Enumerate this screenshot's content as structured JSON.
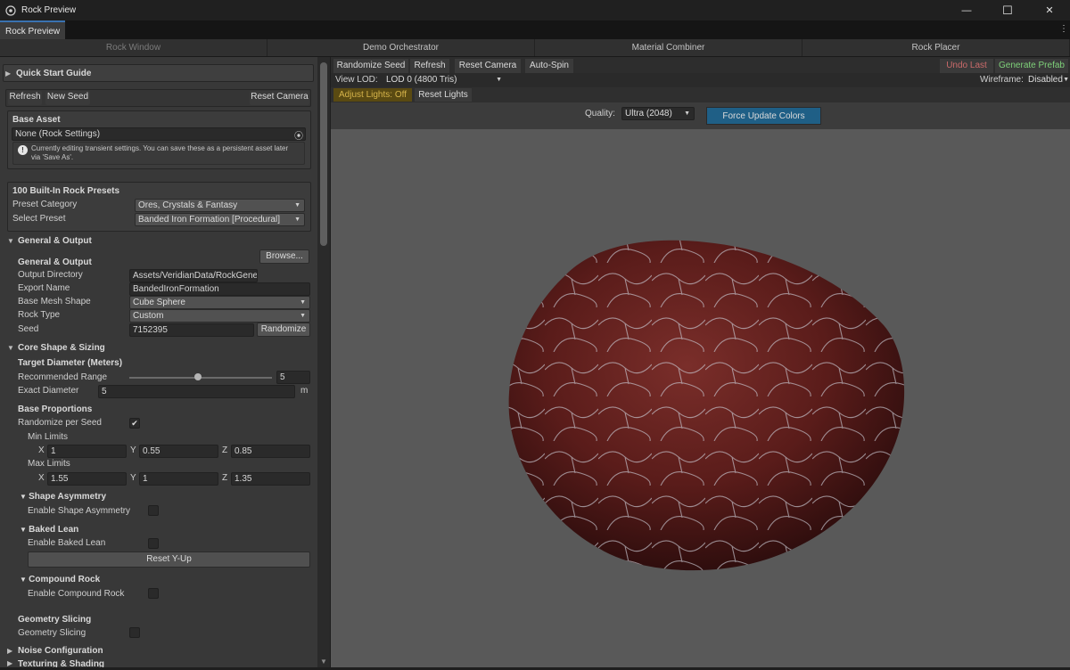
{
  "window": {
    "title": "Rock Preview",
    "controls": {
      "minimize": "—",
      "maximize": "☐",
      "close": "✕"
    }
  },
  "tab": {
    "label": "Rock Preview",
    "menu": "⋮"
  },
  "top_tabs": [
    "Rock Window",
    "Demo Orchestrator",
    "Material Combiner",
    "Rock Placer"
  ],
  "left": {
    "quick_start": "Quick Start Guide",
    "buttons": {
      "refresh": "Refresh",
      "new_seed": "New Seed",
      "reset_camera": "Reset Camera"
    },
    "base_asset": {
      "title": "Base Asset",
      "value": "None (Rock Settings)",
      "info": "Currently editing transient settings. You can save these as a persistent asset later via 'Save As'."
    },
    "presets": {
      "title": "100 Built-In Rock Presets",
      "category_label": "Preset Category",
      "category_value": "Ores, Crystals & Fantasy",
      "select_label": "Select Preset",
      "select_value": "Banded Iron Formation [Procedural]"
    },
    "general": {
      "foldout": "General & Output",
      "browse": "Browse...",
      "header": "General & Output",
      "output_dir_label": "Output Directory",
      "output_dir_value": "Assets/VeridianData/RockGener-",
      "export_label": "Export Name",
      "export_value": "BandedIronFormation",
      "mesh_label": "Base Mesh Shape",
      "mesh_value": "Cube Sphere",
      "type_label": "Rock Type",
      "type_value": "Custom",
      "seed_label": "Seed",
      "seed_value": "7152395",
      "randomize": "Randomize"
    },
    "core": {
      "foldout": "Core Shape & Sizing",
      "target_header": "Target Diameter (Meters)",
      "recommended_label": "Recommended Range",
      "recommended_value": "5",
      "recommended_fraction": 0.48,
      "exact_label": "Exact Diameter",
      "exact_value": "5",
      "exact_unit": "m",
      "proportions_header": "Base Proportions",
      "randomize_label": "Randomize per Seed",
      "randomize_checked": true,
      "min_label": "Min Limits",
      "min": {
        "x": "1",
        "y": "0.55",
        "z": "0.85"
      },
      "max_label": "Max Limits",
      "max": {
        "x": "1.55",
        "y": "1",
        "z": "1.35"
      },
      "axis": {
        "x": "X",
        "y": "Y",
        "z": "Z"
      },
      "asym_header": "Shape Asymmetry",
      "asym_label": "Enable Shape Asymmetry",
      "lean_header": "Baked Lean",
      "lean_label": "Enable Baked Lean",
      "reset_yup": "Reset Y-Up",
      "compound_header": "Compound Rock",
      "compound_label": "Enable Compound Rock",
      "slicing_header": "Geometry Slicing",
      "slicing_label": "Geometry Slicing"
    },
    "noise": {
      "foldout": "Noise Configuration"
    },
    "textures_partial": "Texturing & Shading"
  },
  "right": {
    "toolbar": {
      "randomize_seed": "Randomize Seed",
      "refresh": "Refresh",
      "reset_camera": "Reset Camera",
      "auto_spin": "Auto-Spin",
      "undo_last": "Undo Last",
      "generate_prefab": "Generate Prefab"
    },
    "view_lod_label": "View LOD:",
    "view_lod_value": "LOD 0 (4800 Tris)",
    "wireframe_label": "Wireframe:",
    "wireframe_value": "Disabled",
    "adjust_lights": "Adjust Lights: Off",
    "reset_lights": "Reset Lights",
    "quality_label": "Quality:",
    "quality_value": "Ultra (2048)",
    "force_update": "Force Update Colors"
  },
  "colors": {
    "generate_prefab": "#7fd17a",
    "undo_last": "#c96a6a",
    "adjust_lights_bg": "#5a4a12",
    "adjust_lights_text": "#d6b44a",
    "force_update_bg": "#1f5f86",
    "rock_base": "#5a1c1a"
  }
}
